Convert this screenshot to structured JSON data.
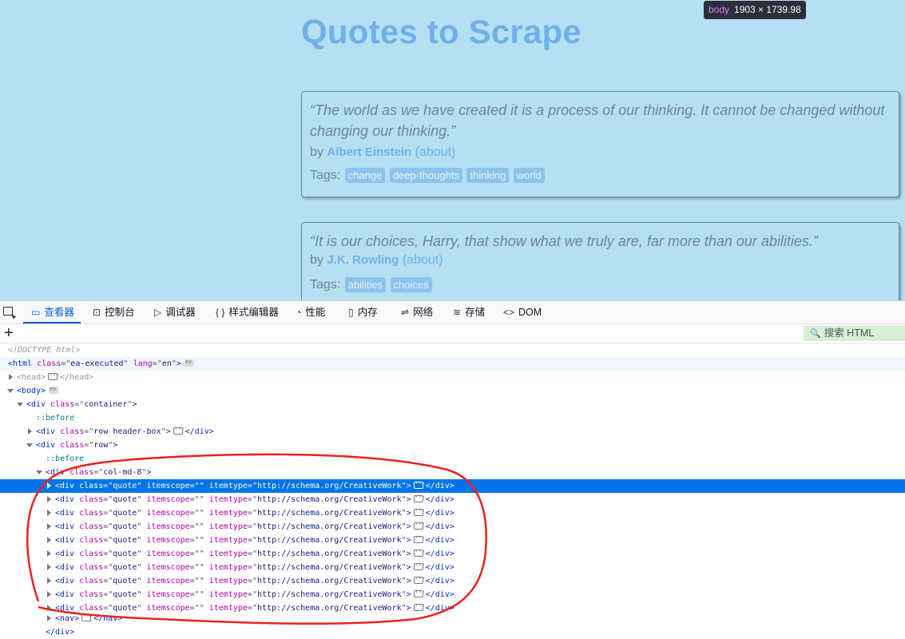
{
  "page": {
    "site_title": "Quotes to Scrape",
    "tooltip": {
      "tag": "body",
      "size": "1903 × 1739.98"
    },
    "quotes": [
      {
        "text": "“The world as we have created it is a process of our thinking. It cannot be changed without changing our thinking.”",
        "by_label": "by",
        "author": "Albert Einstein",
        "about": "(about)",
        "tags_label": "Tags:",
        "tags": [
          "change",
          "deep-thoughts",
          "thinking",
          "world"
        ]
      },
      {
        "text": "“It is our choices, Harry, that show what we truly are, far more than our abilities.”",
        "by_label": "by",
        "author": "J.K. Rowling",
        "about": "(about)",
        "tags_label": "Tags:",
        "tags": [
          "abilities",
          "choices"
        ]
      }
    ]
  },
  "devtools": {
    "tabs": [
      {
        "label": "查看器",
        "icon": "inspector-icon",
        "active": true
      },
      {
        "label": "控制台",
        "icon": "console-icon"
      },
      {
        "label": "调试器",
        "icon": "debugger-icon"
      },
      {
        "label": "样式编辑器",
        "icon": "style-editor-icon"
      },
      {
        "label": "性能",
        "icon": "performance-icon"
      },
      {
        "label": "内存",
        "icon": "memory-icon"
      },
      {
        "label": "网络",
        "icon": "network-icon"
      },
      {
        "label": "存储",
        "icon": "storage-icon"
      },
      {
        "label": "DOM",
        "icon": "dom-icon"
      }
    ],
    "search_placeholder": "搜索 HTML",
    "tree": {
      "doctype": "<!DOCTYPE html>",
      "html_class": "ea-executed",
      "html_lang": "en",
      "container_class": "container",
      "before": "::before",
      "header_class": "row header-box",
      "row_class": "row",
      "col_class": "col-md-8",
      "quote_class": "quote",
      "quote_itemscope": "",
      "quote_itemtype": "http://schema.org/CreativeWork",
      "quote_count": 10,
      "selected_index": 0,
      "nav_tag": "nav"
    }
  },
  "colors": {
    "highlight": "#b5e0f2",
    "selection": "#0074e8",
    "annotation": "#e8231f"
  }
}
